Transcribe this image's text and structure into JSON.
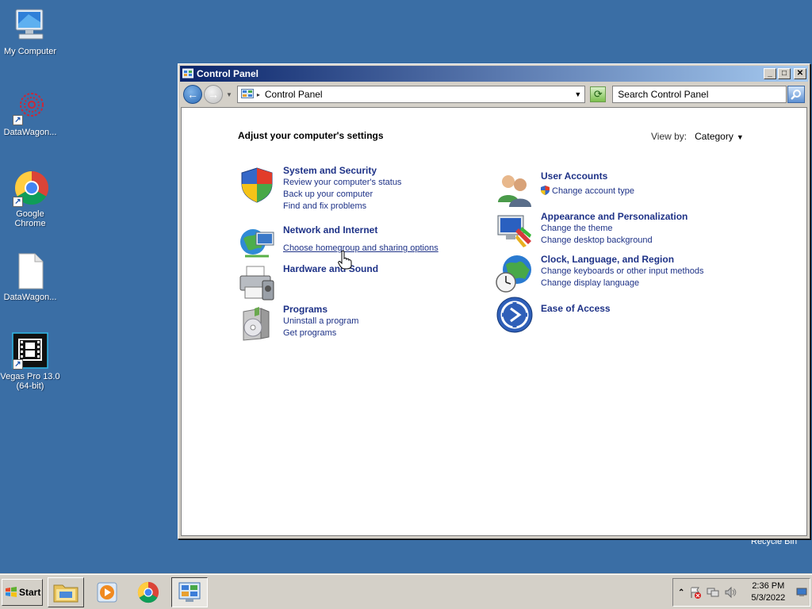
{
  "desktop": {
    "icons": [
      {
        "label": "My Computer",
        "icon": "computer-icon"
      },
      {
        "label": "DataWagon...",
        "icon": "datawagon-logo-icon"
      },
      {
        "label": "Google Chrome",
        "icon": "chrome-icon"
      },
      {
        "label": "DataWagon...",
        "icon": "document-icon"
      },
      {
        "label": "Vegas Pro 13.0 (64-bit)",
        "icon": "vegas-pro-icon"
      }
    ],
    "recycle_bin_label": "Recycle Bin"
  },
  "window": {
    "title": "Control Panel",
    "address": "Control Panel",
    "search_placeholder": "Search Control Panel",
    "heading": "Adjust your computer's settings",
    "view_by_label": "View by:",
    "view_by_value": "Category",
    "categories_left": [
      {
        "title": "System and Security",
        "icon": "shield-icon",
        "links": [
          "Review your computer's status",
          "Back up your computer",
          "Find and fix problems"
        ]
      },
      {
        "title": "Network and Internet",
        "icon": "network-globe-icon",
        "links": [
          "Choose homegroup and sharing options"
        ]
      },
      {
        "title": "Hardware and Sound",
        "icon": "printer-icon",
        "links": []
      },
      {
        "title": "Programs",
        "icon": "programs-icon",
        "links": [
          "Uninstall a program",
          "Get programs"
        ]
      }
    ],
    "categories_right": [
      {
        "title": "User Accounts",
        "icon": "users-icon",
        "links": [
          "Change account type"
        ]
      },
      {
        "title": "Appearance and Personalization",
        "icon": "monitor-paint-icon",
        "links": [
          "Change the theme",
          "Change desktop background"
        ]
      },
      {
        "title": "Clock, Language, and Region",
        "icon": "clock-globe-icon",
        "links": [
          "Change keyboards or other input methods",
          "Change display language"
        ]
      },
      {
        "title": "Ease of Access",
        "icon": "ease-of-access-icon",
        "links": []
      }
    ]
  },
  "taskbar": {
    "start_label": "Start",
    "time": "2:36 PM",
    "date": "5/3/2022"
  },
  "colors": {
    "desktop": "#3a6ea5",
    "link": "#1e3287",
    "title_gradient_start": "#0a246a"
  }
}
